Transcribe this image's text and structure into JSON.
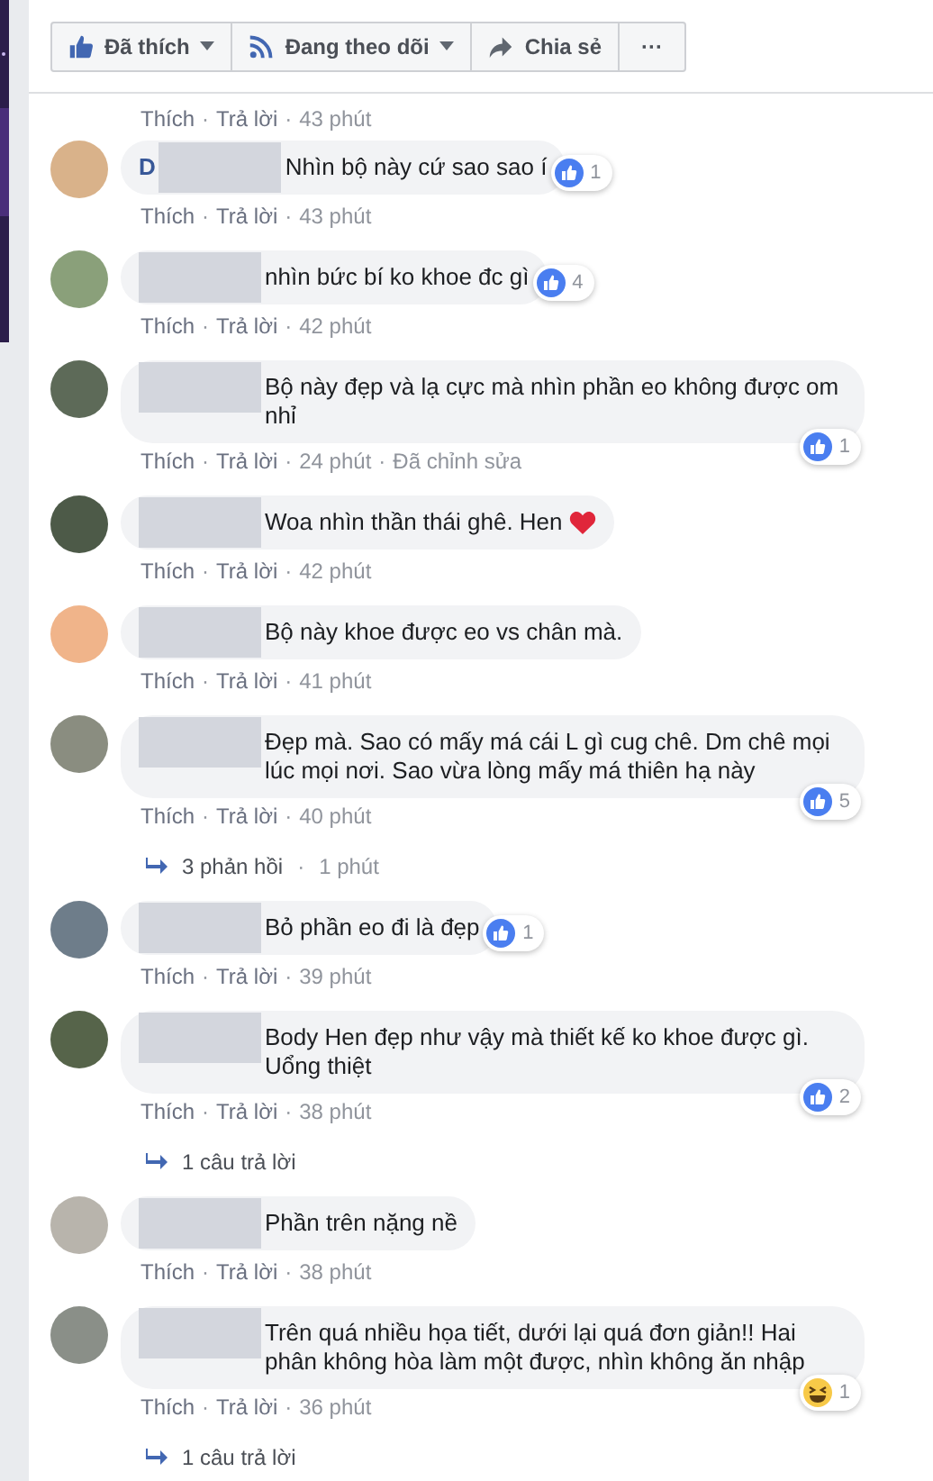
{
  "action_bar": [
    {
      "kind": "like",
      "label": "Đã thích",
      "dropdown": true
    },
    {
      "kind": "follow",
      "label": "Đang theo dõi",
      "dropdown": true
    },
    {
      "kind": "share",
      "label": "Chia sẻ",
      "dropdown": false
    },
    {
      "kind": "more",
      "label": "···",
      "dropdown": false
    }
  ],
  "comments": [
    {
      "kind": "actions_only",
      "meta": [
        {
          "kind": "link",
          "text": "Thích"
        },
        {
          "kind": "sep",
          "text": "·"
        },
        {
          "kind": "link",
          "text": "Trả lời"
        },
        {
          "kind": "sep",
          "text": "·"
        },
        {
          "kind": "time",
          "text": "43 phút"
        }
      ]
    },
    {
      "kind": "comment",
      "name": "D",
      "text": "Nhìn bộ này cứ sao sao í",
      "reaction": {
        "kind": "like",
        "count": "1"
      },
      "meta": [
        {
          "kind": "link",
          "text": "Thích"
        },
        {
          "kind": "sep",
          "text": "·"
        },
        {
          "kind": "link",
          "text": "Trả lời"
        },
        {
          "kind": "sep",
          "text": "·"
        },
        {
          "kind": "time",
          "text": "43 phút"
        }
      ]
    },
    {
      "kind": "comment",
      "text": "nhìn bức bí ko khoe đc gì",
      "reaction": {
        "kind": "like",
        "count": "4"
      },
      "meta": [
        {
          "kind": "link",
          "text": "Thích"
        },
        {
          "kind": "sep",
          "text": "·"
        },
        {
          "kind": "link",
          "text": "Trả lời"
        },
        {
          "kind": "sep",
          "text": "·"
        },
        {
          "kind": "time",
          "text": "42 phút"
        }
      ]
    },
    {
      "kind": "comment",
      "text": "Bộ này đẹp và lạ cực mà nhìn phần eo không được om nhỉ",
      "reaction": {
        "kind": "like",
        "count": "1"
      },
      "meta": [
        {
          "kind": "link",
          "text": "Thích"
        },
        {
          "kind": "sep",
          "text": "·"
        },
        {
          "kind": "link",
          "text": "Trả lời"
        },
        {
          "kind": "sep",
          "text": "·"
        },
        {
          "kind": "time",
          "text": "24 phút"
        },
        {
          "kind": "sep",
          "text": "·"
        },
        {
          "kind": "time",
          "text": "Đã chỉnh sửa"
        }
      ]
    },
    {
      "kind": "comment",
      "text": "Woa nhìn thần thái ghê. Hen",
      "trailing": {
        "kind": "heart"
      },
      "meta": [
        {
          "kind": "link",
          "text": "Thích"
        },
        {
          "kind": "sep",
          "text": "·"
        },
        {
          "kind": "link",
          "text": "Trả lời"
        },
        {
          "kind": "sep",
          "text": "·"
        },
        {
          "kind": "time",
          "text": "42 phút"
        }
      ]
    },
    {
      "kind": "comment",
      "text": "Bộ này khoe được eo vs chân mà.",
      "meta": [
        {
          "kind": "link",
          "text": "Thích"
        },
        {
          "kind": "sep",
          "text": "·"
        },
        {
          "kind": "link",
          "text": "Trả lời"
        },
        {
          "kind": "sep",
          "text": "·"
        },
        {
          "kind": "time",
          "text": "41 phút"
        }
      ]
    },
    {
      "kind": "comment",
      "text": "Đẹp mà. Sao có mấy má cái L gì cug chê. Dm chê mọi lúc mọi nơi. Sao vừa lòng mấy má thiên hạ này",
      "reaction": {
        "kind": "like",
        "count": "5"
      },
      "meta": [
        {
          "kind": "link",
          "text": "Thích"
        },
        {
          "kind": "sep",
          "text": "·"
        },
        {
          "kind": "link",
          "text": "Trả lời"
        },
        {
          "kind": "sep",
          "text": "·"
        },
        {
          "kind": "time",
          "text": "40 phút"
        }
      ],
      "replies": {
        "label": "3 phản hồi",
        "sep": "·",
        "time": "1 phút"
      }
    },
    {
      "kind": "comment",
      "text": "Bỏ phần eo đi là đẹp",
      "reaction": {
        "kind": "like",
        "count": "1"
      },
      "meta": [
        {
          "kind": "link",
          "text": "Thích"
        },
        {
          "kind": "sep",
          "text": "·"
        },
        {
          "kind": "link",
          "text": "Trả lời"
        },
        {
          "kind": "sep",
          "text": "·"
        },
        {
          "kind": "time",
          "text": "39 phút"
        }
      ]
    },
    {
      "kind": "comment",
      "text": "Body Hen đẹp như vậy mà thiết kế ko khoe được gì. Uổng thiệt",
      "reaction": {
        "kind": "like",
        "count": "2"
      },
      "meta": [
        {
          "kind": "link",
          "text": "Thích"
        },
        {
          "kind": "sep",
          "text": "·"
        },
        {
          "kind": "link",
          "text": "Trả lời"
        },
        {
          "kind": "sep",
          "text": "·"
        },
        {
          "kind": "time",
          "text": "38 phút"
        }
      ],
      "replies": {
        "label": "1 câu trả lời"
      }
    },
    {
      "kind": "comment",
      "text": "Phần trên nặng nề",
      "meta": [
        {
          "kind": "link",
          "text": "Thích"
        },
        {
          "kind": "sep",
          "text": "·"
        },
        {
          "kind": "link",
          "text": "Trả lời"
        },
        {
          "kind": "sep",
          "text": "·"
        },
        {
          "kind": "time",
          "text": "38 phút"
        }
      ]
    },
    {
      "kind": "comment",
      "text": "Trên quá nhiều họa tiết, dưới lại quá đơn giản!! Hai phân không hòa làm một được, nhìn không ăn nhập",
      "reaction": {
        "kind": "haha",
        "count": "1"
      },
      "meta": [
        {
          "kind": "link",
          "text": "Thích"
        },
        {
          "kind": "sep",
          "text": "·"
        },
        {
          "kind": "link",
          "text": "Trả lời"
        },
        {
          "kind": "sep",
          "text": "·"
        },
        {
          "kind": "time",
          "text": "36 phút"
        }
      ],
      "replies": {
        "label": "1 câu trả lời"
      }
    }
  ]
}
